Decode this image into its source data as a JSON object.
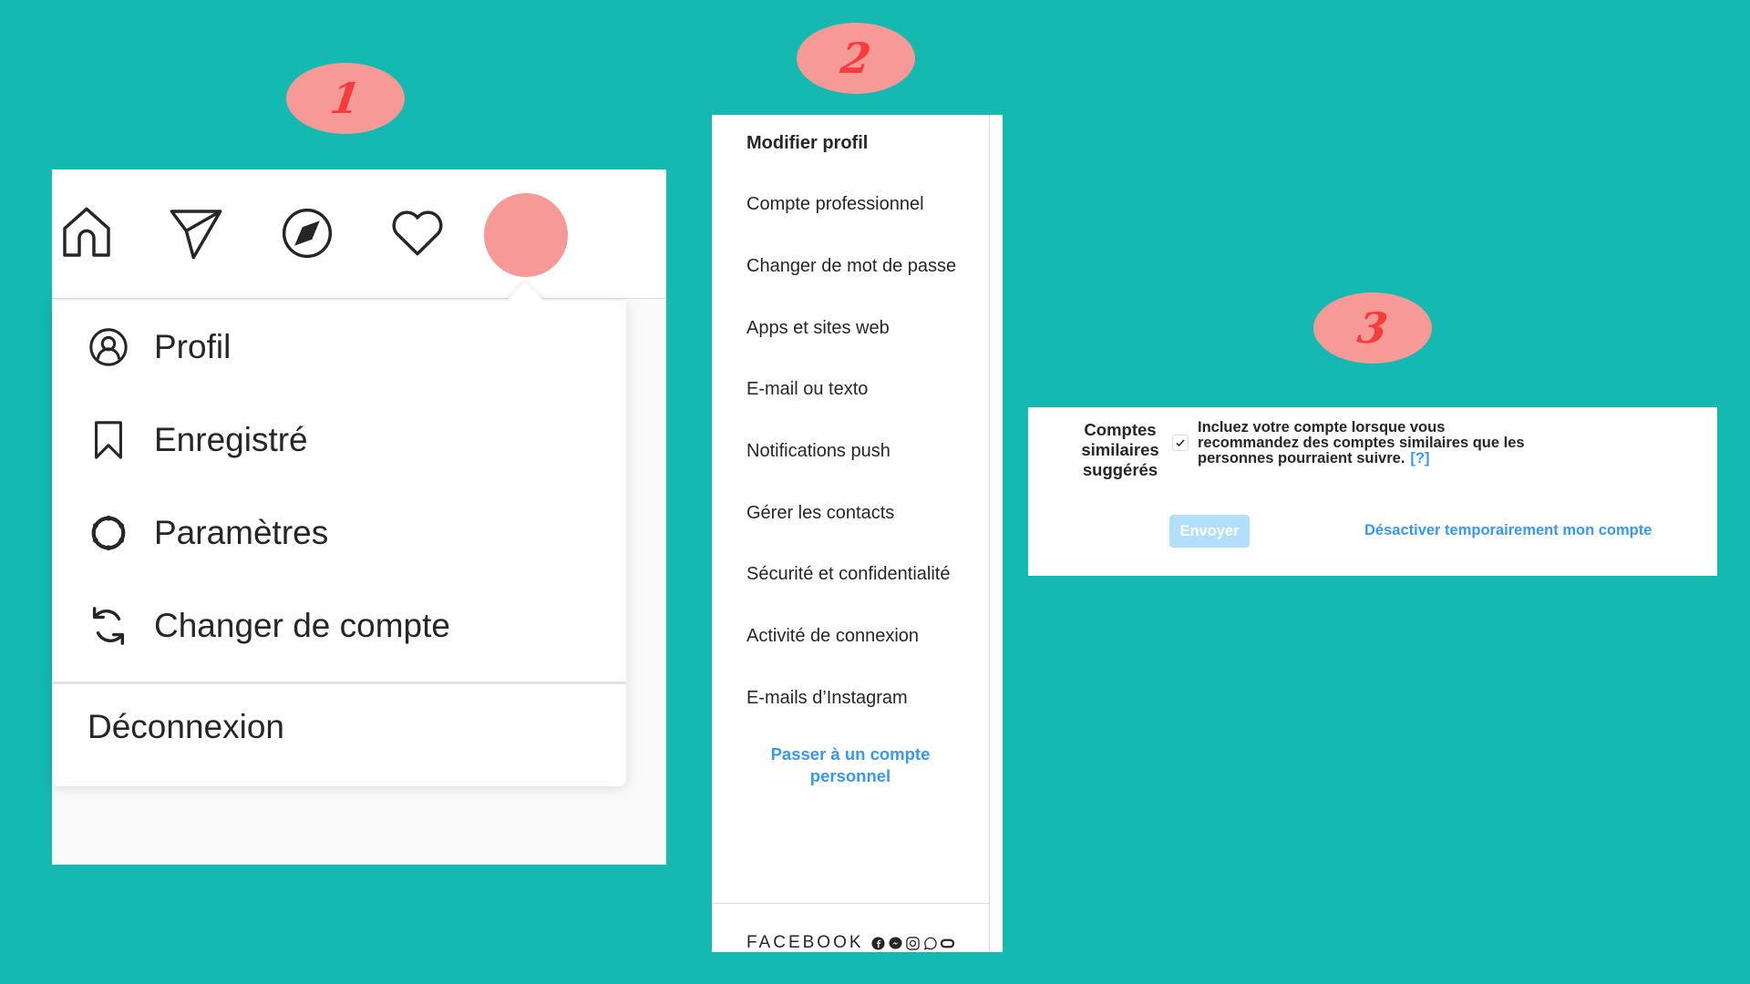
{
  "badges": [
    "1",
    "2",
    "3"
  ],
  "panel1": {
    "nav_icons": [
      "home-icon",
      "direct-message-icon",
      "explore-compass-icon",
      "activity-heart-icon",
      "profile-avatar"
    ],
    "menu": {
      "items": [
        {
          "label": "Profil",
          "icon": "profile-circle-icon"
        },
        {
          "label": "Enregistré",
          "icon": "bookmark-icon"
        },
        {
          "label": "Paramètres",
          "icon": "settings-gear-icon"
        },
        {
          "label": "Changer de compte",
          "icon": "switch-account-icon"
        }
      ],
      "logout_label": "Déconnexion"
    }
  },
  "panel2": {
    "items": [
      {
        "label": "Modifier profil",
        "active": true
      },
      {
        "label": "Compte professionnel"
      },
      {
        "label": "Changer de mot de passe"
      },
      {
        "label": "Apps et sites web"
      },
      {
        "label": "E-mail ou texto"
      },
      {
        "label": "Notifications push"
      },
      {
        "label": "Gérer les contacts"
      },
      {
        "label": "Sécurité et confidentialité"
      },
      {
        "label": "Activité de connexion"
      },
      {
        "label": "E-mails d’Instagram"
      }
    ],
    "switch_link_line1": "Passer à un compte",
    "switch_link_line2": "personnel",
    "footer_brand": "FACEBOOK",
    "footer_icons": [
      "facebook-icon",
      "messenger-icon",
      "instagram-icon",
      "whatsapp-icon",
      "oculus-icon"
    ]
  },
  "panel3": {
    "label_line1": "Comptes",
    "label_line2": "similaires",
    "label_line3": "suggérés",
    "checkbox_checked": true,
    "desc_line1": "Incluez votre compte lorsque vous",
    "desc_line2": "recommandez des comptes similaires que les",
    "desc_line3": "personnes pourraient suivre.",
    "help_link": "[?]",
    "submit_label": "Envoyer",
    "submit_disabled": true,
    "deactivate_link": "Désactiver temporairement mon compte"
  },
  "colors": {
    "background": "#14b9b1",
    "badge_fill": "#f79a97",
    "badge_text": "#f83b3b",
    "link_blue": "#3897f0",
    "button_disabled": "#b2dffc"
  }
}
